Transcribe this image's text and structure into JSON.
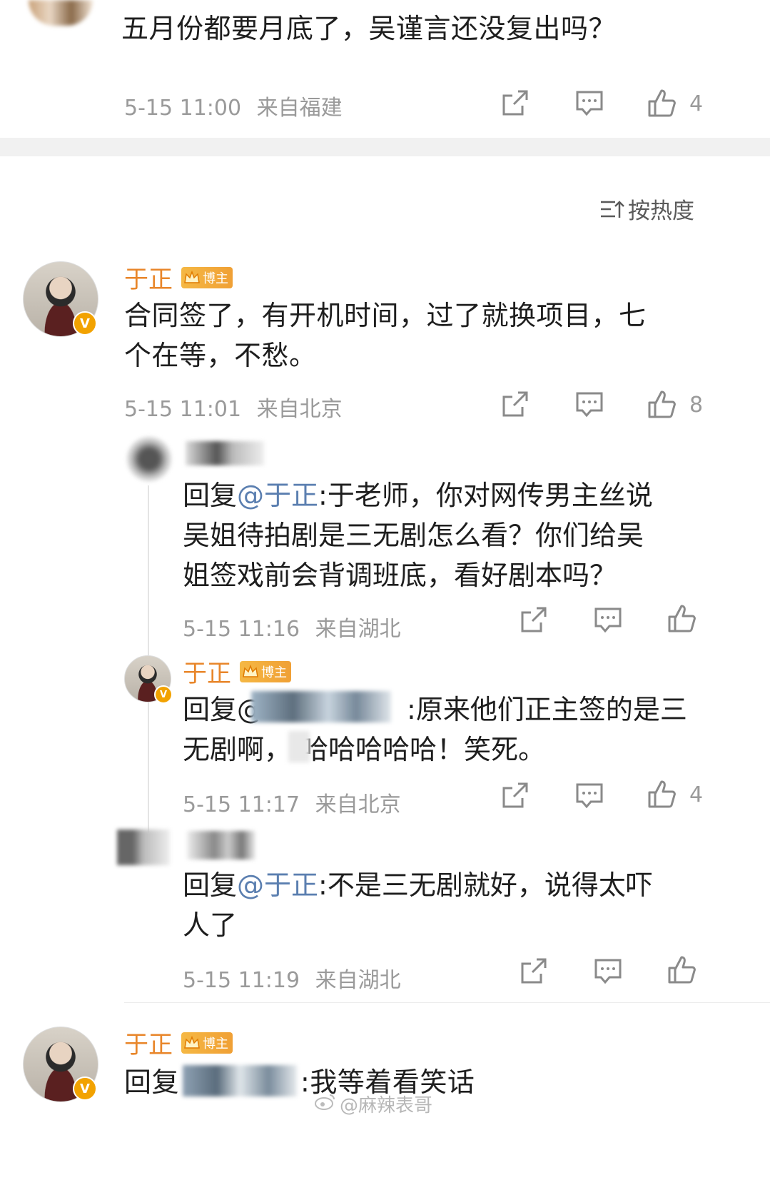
{
  "top_comment": {
    "text": "五月份都要月底了，吴谨言还没复出吗？",
    "time": "5-15 11:00",
    "location": "来自福建",
    "likes": "4"
  },
  "sort": {
    "label": "按热度"
  },
  "badge_label": "博主",
  "main_comment": {
    "author": "于正",
    "text_line1": "合同签了，有开机时间，过了就换项目，七",
    "text_line2": "个在等，不愁。",
    "time": "5-15 11:01",
    "location": "来自北京",
    "likes": "8"
  },
  "reply1": {
    "prefix": "回复",
    "mention": "@于正",
    "line1_rest": ":于老师，你对网传男主丝说",
    "line2": "吴姐待拍剧是三无剧怎么看？你们给吴",
    "line3": "姐签戏前会背调班底，看好剧本吗？",
    "time": "5-15 11:16",
    "location": "来自湖北"
  },
  "reply2": {
    "author": "于正",
    "prefix": "回复@",
    "line1_rest": ":原来他们正主签的是三",
    "line2_a": "无剧啊，",
    "line2_b": "哈哈哈哈哈！笑死。",
    "time": "5-15 11:17",
    "location": "来自北京",
    "likes": "4"
  },
  "reply3": {
    "prefix": "回复",
    "mention": "@于正",
    "line1_rest": ":不是三无剧就好，说得太吓",
    "line2": "人了",
    "time": "5-15 11:19",
    "location": "来自湖北"
  },
  "bottom_comment": {
    "author": "于正",
    "prefix": "回复",
    "rest": ":我等着看笑话"
  },
  "watermark": "@麻辣表哥",
  "colors": {
    "name": "#e8862a",
    "mention": "#5b7fb0",
    "meta": "#9a9a9a",
    "badge": "#f0a035"
  }
}
